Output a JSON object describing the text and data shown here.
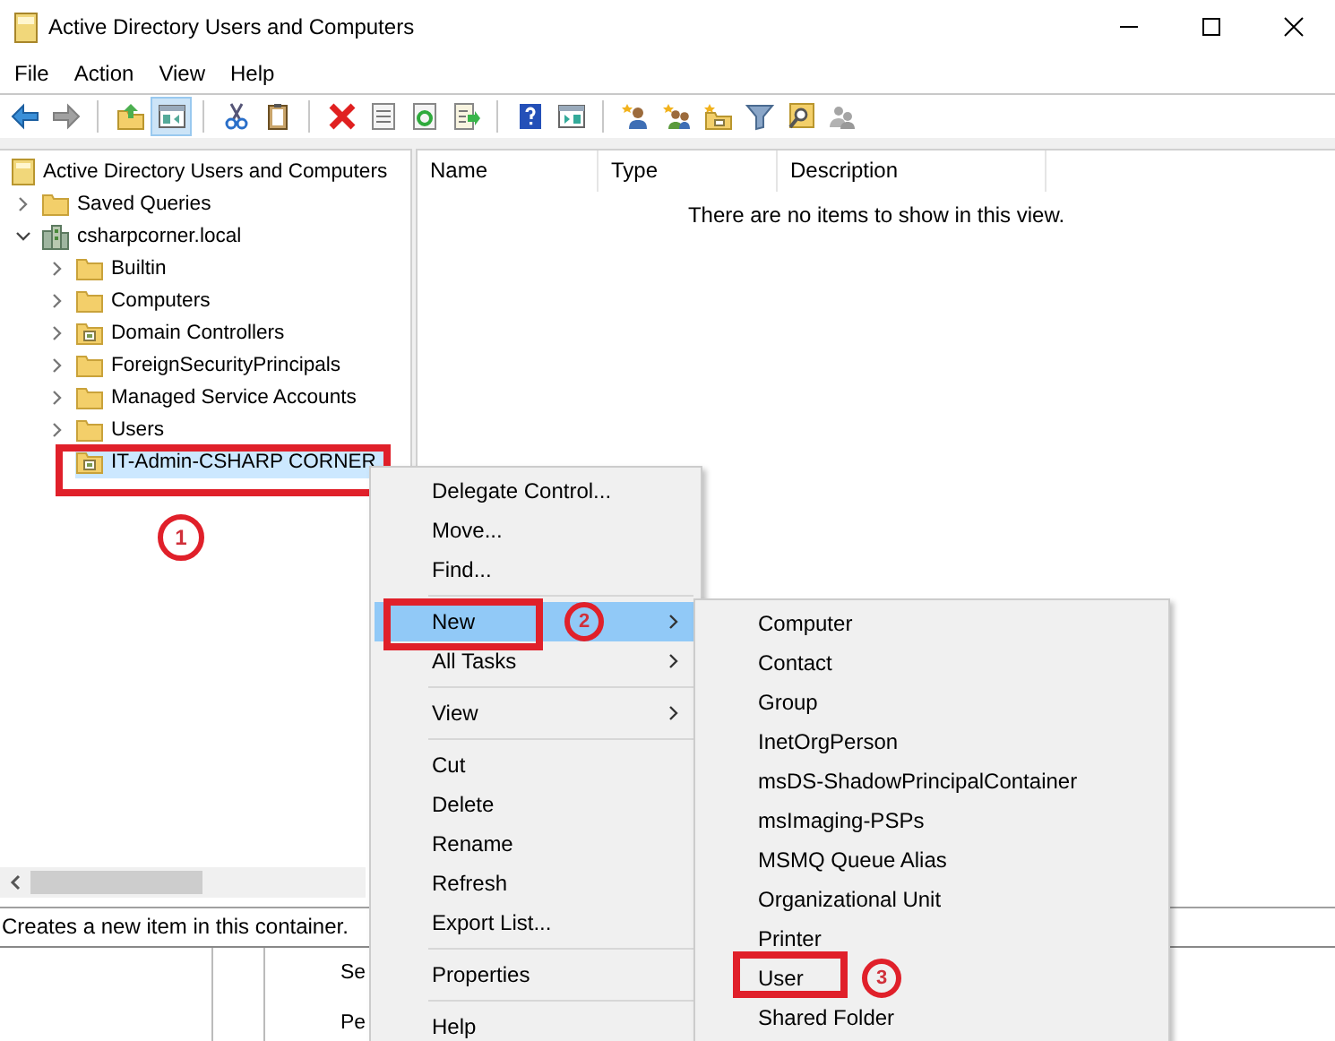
{
  "window": {
    "title": "Active Directory Users and Computers",
    "controls": [
      {
        "kind": "minimize"
      },
      {
        "kind": "maximize"
      },
      {
        "kind": "close"
      }
    ]
  },
  "menu_bar": [
    "File",
    "Action",
    "View",
    "Help"
  ],
  "toolbar": [
    {
      "kind": "back",
      "disabled": false,
      "selected": false
    },
    {
      "kind": "forward",
      "disabled": true,
      "selected": false
    },
    {
      "kind": "separator"
    },
    {
      "kind": "up",
      "disabled": false,
      "selected": false
    },
    {
      "kind": "tree-toggle",
      "disabled": false,
      "selected": true
    },
    {
      "kind": "separator"
    },
    {
      "kind": "cut",
      "disabled": false,
      "selected": false
    },
    {
      "kind": "paste",
      "disabled": false,
      "selected": false
    },
    {
      "kind": "separator"
    },
    {
      "kind": "delete",
      "disabled": false,
      "selected": false
    },
    {
      "kind": "properties",
      "disabled": false,
      "selected": false
    },
    {
      "kind": "refresh",
      "disabled": false,
      "selected": false
    },
    {
      "kind": "export",
      "disabled": false,
      "selected": false
    },
    {
      "kind": "separator"
    },
    {
      "kind": "help",
      "disabled": false,
      "selected": false
    },
    {
      "kind": "console",
      "disabled": false,
      "selected": false
    },
    {
      "kind": "separator"
    },
    {
      "kind": "new-user",
      "disabled": false,
      "selected": false
    },
    {
      "kind": "new-group",
      "disabled": false,
      "selected": false
    },
    {
      "kind": "new-ou",
      "disabled": false,
      "selected": false
    },
    {
      "kind": "filter",
      "disabled": false,
      "selected": false
    },
    {
      "kind": "find",
      "disabled": false,
      "selected": false
    },
    {
      "kind": "add-to-group",
      "disabled": true,
      "selected": false
    }
  ],
  "tree": {
    "items": [
      {
        "kind": "root",
        "label": "Active Directory Users and Computers",
        "selected": false,
        "children": [
          {
            "kind": "folder",
            "label": "Saved Queries",
            "expanded": false,
            "selected": false
          },
          {
            "kind": "domain",
            "label": "csharpcorner.local",
            "expanded": true,
            "selected": false,
            "children": [
              {
                "kind": "folder",
                "label": "Builtin",
                "expanded": false,
                "selected": false
              },
              {
                "kind": "folder",
                "label": "Computers",
                "expanded": false,
                "selected": false
              },
              {
                "kind": "ou",
                "label": "Domain Controllers",
                "expanded": false,
                "selected": false
              },
              {
                "kind": "folder",
                "label": "ForeignSecurityPrincipals",
                "expanded": false,
                "selected": false
              },
              {
                "kind": "folder",
                "label": "Managed Service Accounts",
                "expanded": false,
                "selected": false
              },
              {
                "kind": "folder",
                "label": "Users",
                "expanded": false,
                "selected": false
              },
              {
                "kind": "ou",
                "label": "IT-Admin-CSHARP CORNER",
                "selected": true,
                "callout": "1"
              }
            ]
          }
        ]
      }
    ]
  },
  "list_view": {
    "columns": [
      "Name",
      "Type",
      "Description"
    ],
    "empty_message": "There are no items to show in this view."
  },
  "status_bar": "Creates a new item in this container.",
  "background_window": {
    "texts": [
      "Se",
      "Pe"
    ]
  },
  "context_menu": {
    "items": [
      {
        "kind": "item",
        "label": "Delegate Control...",
        "selected": false
      },
      {
        "kind": "item",
        "label": "Move...",
        "selected": false
      },
      {
        "kind": "item",
        "label": "Find...",
        "selected": false
      },
      {
        "kind": "separator"
      },
      {
        "kind": "submenu",
        "label": "New",
        "selected": true,
        "callout": "2"
      },
      {
        "kind": "submenu",
        "label": "All Tasks",
        "selected": false
      },
      {
        "kind": "separator"
      },
      {
        "kind": "submenu",
        "label": "View",
        "selected": false
      },
      {
        "kind": "separator"
      },
      {
        "kind": "item",
        "label": "Cut",
        "selected": false
      },
      {
        "kind": "item",
        "label": "Delete",
        "selected": false
      },
      {
        "kind": "item",
        "label": "Rename",
        "selected": false
      },
      {
        "kind": "item",
        "label": "Refresh",
        "selected": false
      },
      {
        "kind": "item",
        "label": "Export List...",
        "selected": false
      },
      {
        "kind": "separator"
      },
      {
        "kind": "item",
        "label": "Properties",
        "selected": false
      },
      {
        "kind": "separator"
      },
      {
        "kind": "item",
        "label": "Help",
        "selected": false
      }
    ]
  },
  "submenu": {
    "items": [
      {
        "kind": "item",
        "label": "Computer",
        "selected": false
      },
      {
        "kind": "item",
        "label": "Contact",
        "selected": false
      },
      {
        "kind": "item",
        "label": "Group",
        "selected": false
      },
      {
        "kind": "item",
        "label": "InetOrgPerson",
        "selected": false
      },
      {
        "kind": "item",
        "label": "msDS-ShadowPrincipalContainer",
        "selected": false
      },
      {
        "kind": "item",
        "label": "msImaging-PSPs",
        "selected": false
      },
      {
        "kind": "item",
        "label": "MSMQ Queue Alias",
        "selected": false
      },
      {
        "kind": "item",
        "label": "Organizational Unit",
        "selected": false
      },
      {
        "kind": "item",
        "label": "Printer",
        "selected": false
      },
      {
        "kind": "item",
        "label": "User",
        "selected": false,
        "callout": "3"
      },
      {
        "kind": "item",
        "label": "Shared Folder",
        "selected": false
      }
    ]
  }
}
